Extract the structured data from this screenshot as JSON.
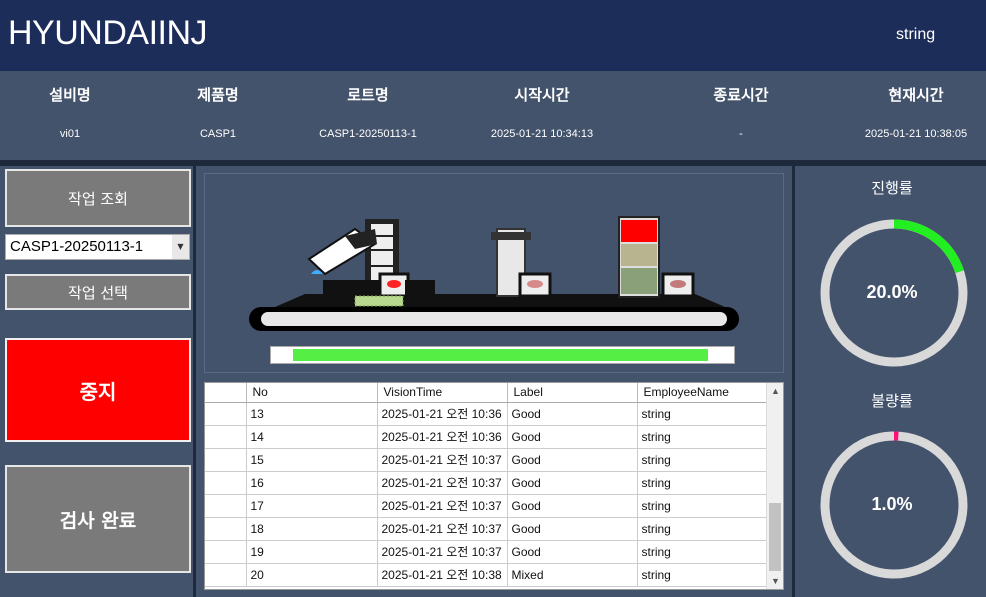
{
  "header": {
    "brand": "HYUNDAIINJ",
    "user": "string"
  },
  "info": {
    "columns": [
      {
        "label": "설비명",
        "value": "vi01"
      },
      {
        "label": "제품명",
        "value": "CASP1"
      },
      {
        "label": "로트명",
        "value": "CASP1-20250113-1"
      },
      {
        "label": "시작시간",
        "value": "2025-01-21 10:34:13"
      },
      {
        "label": "종료시간",
        "value": "-"
      },
      {
        "label": "현재시간",
        "value": "2025-01-21 10:38:05"
      }
    ]
  },
  "left": {
    "query_button": "작업 조회",
    "lot_select": {
      "value": "CASP1-20250113-1"
    },
    "select_button": "작업 선택",
    "stop_button": "중지",
    "complete_button": "검사 완료"
  },
  "progress": {
    "fraction": 0.95
  },
  "grid": {
    "headers": [
      "No",
      "VisionTime",
      "Label",
      "EmployeeName"
    ],
    "rows": [
      [
        "13",
        "2025-01-21 오전 10:36",
        "Good",
        "string"
      ],
      [
        "14",
        "2025-01-21 오전 10:36",
        "Good",
        "string"
      ],
      [
        "15",
        "2025-01-21 오전 10:37",
        "Good",
        "string"
      ],
      [
        "16",
        "2025-01-21 오전 10:37",
        "Good",
        "string"
      ],
      [
        "17",
        "2025-01-21 오전 10:37",
        "Good",
        "string"
      ],
      [
        "18",
        "2025-01-21 오전 10:37",
        "Good",
        "string"
      ],
      [
        "19",
        "2025-01-21 오전 10:37",
        "Good",
        "string"
      ],
      [
        "20",
        "2025-01-21 오전 10:38",
        "Mixed",
        "string"
      ]
    ]
  },
  "stats": {
    "progress_rate": {
      "label": "진행률",
      "value_text": "20.0%",
      "percent": 20.0,
      "color": "#22ee22"
    },
    "defect_rate": {
      "label": "불량률",
      "value_text": "1.0%",
      "percent": 1.0,
      "color": "#ff1177"
    }
  },
  "colors": {
    "stop": "#ff0000",
    "header_bg": "#1d2d5a",
    "panel_bg": "#44536c"
  }
}
